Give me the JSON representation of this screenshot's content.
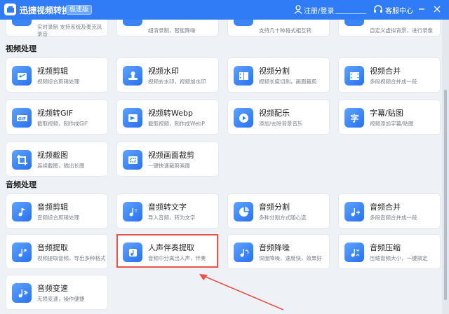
{
  "titlebar": {
    "app_title": "迅捷视频转换器",
    "badge": "极速版",
    "login": "注册/登录",
    "customer_service": "客服中心",
    "accent_color": "#2f7cf6",
    "icons": [
      "logo-icon",
      "user-icon",
      "headset-icon",
      "minimize-icon",
      "close-icon"
    ]
  },
  "top_partial_row": [
    {
      "line1": "实时录制 支持系统及麦克风",
      "line2": "录音"
    },
    {
      "line1": "超清录制，智能降噪",
      "line2": ""
    },
    {
      "line1": "支持几十种格式相互转",
      "line2": ""
    },
    {
      "line1": "自定义虚拟背景，进行录像",
      "line2": ""
    }
  ],
  "sections": [
    {
      "title": "视频处理",
      "rows": [
        [
          {
            "title": "视频剪辑",
            "desc": "视频综合剪辑处理",
            "icon": "scissors-icon"
          },
          {
            "title": "视频水印",
            "desc": "视频去水印，视频加水印",
            "icon": "stamp-icon"
          },
          {
            "title": "视频分割",
            "desc": "视频长度切割，画面裁剪",
            "icon": "film-split-icon"
          },
          {
            "title": "视频合并",
            "desc": "多段视频合并成一段",
            "icon": "film-merge-icon"
          }
        ],
        [
          {
            "title": "视频转GIF",
            "desc": "截取视频，制作成GIF",
            "icon": "gif-icon"
          },
          {
            "title": "视频转Webp",
            "desc": "截取视频，制作成WebP",
            "icon": "webp-icon"
          },
          {
            "title": "视频配乐",
            "desc": "添加/去除背景音乐",
            "icon": "play-music-icon"
          },
          {
            "title": "字幕/贴图",
            "desc": "视频添加字幕/贴图",
            "icon": "subtitle-icon"
          }
        ],
        [
          {
            "title": "视频截图",
            "desc": "连续截图，输出长图",
            "icon": "crop-icon"
          },
          {
            "title": "视频画面裁剪",
            "desc": "一键快速裁剪画面",
            "icon": "frame-crop-icon"
          }
        ]
      ]
    },
    {
      "title": "音频处理",
      "rows": [
        [
          {
            "title": "音频剪辑",
            "desc": "音频综合剪辑处理",
            "icon": "audio-cut-icon"
          },
          {
            "title": "音频转文字",
            "desc": "导入音频，转为文字",
            "icon": "audio-text-icon"
          },
          {
            "title": "音频分割",
            "desc": "多种分割方式随心选",
            "icon": "audio-split-icon"
          },
          {
            "title": "音频合并",
            "desc": "多段音频合并成一段",
            "icon": "audio-merge-icon"
          }
        ],
        [
          {
            "title": "音频提取",
            "desc": "视频提取音频，导出多种格式",
            "icon": "audio-extract-icon"
          },
          {
            "title": "人声伴奏提取",
            "desc": "音频中分离出人声，伴奏",
            "icon": "vocal-separate-icon"
          },
          {
            "title": "音频降噪",
            "desc": "深度降噪，速度快，效果好",
            "icon": "denoise-icon"
          },
          {
            "title": "音频压缩",
            "desc": "压缩音频大小，一键搞定",
            "icon": "compress-icon"
          }
        ],
        [
          {
            "title": "音频变速",
            "desc": "无损变速，操作便捷",
            "icon": "speed-icon"
          }
        ]
      ]
    }
  ],
  "annotation": {
    "highlight_color": "#e8534a",
    "highlighted_item": "人声伴奏提取"
  }
}
